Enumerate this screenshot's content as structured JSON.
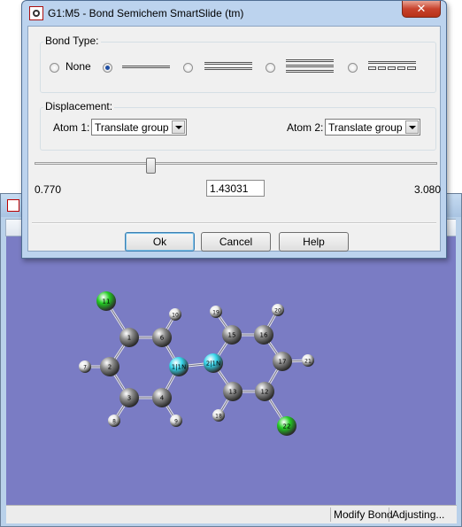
{
  "dialog": {
    "title": "G1:M5 - Bond Semichem SmartSlide (tm)",
    "close_glyph": "✕",
    "bond_type": {
      "label": "Bond Type:",
      "none_label": "None",
      "selected": "single"
    },
    "displacement": {
      "label": "Displacement:",
      "atom1_label": "Atom 1:",
      "atom1_value": "Translate group",
      "atom2_label": "Atom 2:",
      "atom2_value": "Translate group"
    },
    "slider": {
      "min_label": "0.770",
      "max_label": "3.080",
      "value": "1.43031"
    },
    "buttons": {
      "ok": "Ok",
      "cancel": "Cancel",
      "help": "Help"
    }
  },
  "status": {
    "mode": "Modify Bond",
    "state": "Adjusting..."
  },
  "molecule": {
    "atoms": [
      {
        "id": "1",
        "label": "1",
        "element": "C"
      },
      {
        "id": "2",
        "label": "2",
        "element": "C"
      },
      {
        "id": "3",
        "label": "3",
        "element": "C"
      },
      {
        "id": "4",
        "label": "4",
        "element": "C"
      },
      {
        "id": "6",
        "label": "6",
        "element": "C"
      },
      {
        "id": "7",
        "label": "7",
        "element": "H"
      },
      {
        "id": "8",
        "label": "8",
        "element": "H"
      },
      {
        "id": "9",
        "label": "9",
        "element": "H"
      },
      {
        "id": "10",
        "label": "10",
        "element": "H"
      },
      {
        "id": "11",
        "label": "11",
        "element": "Cl"
      },
      {
        "id": "1N",
        "label": "1|1N",
        "element": "N"
      },
      {
        "id": "2N",
        "label": "2|1N",
        "element": "N"
      },
      {
        "id": "12",
        "label": "12",
        "element": "C"
      },
      {
        "id": "13",
        "label": "13",
        "element": "C"
      },
      {
        "id": "15",
        "label": "15",
        "element": "C"
      },
      {
        "id": "16",
        "label": "16",
        "element": "C"
      },
      {
        "id": "17",
        "label": "17",
        "element": "C"
      },
      {
        "id": "18",
        "label": "18",
        "element": "H"
      },
      {
        "id": "19",
        "label": "19",
        "element": "H"
      },
      {
        "id": "20",
        "label": "20",
        "element": "H"
      },
      {
        "id": "21",
        "label": "21",
        "element": "H"
      },
      {
        "id": "22",
        "label": "22",
        "element": "Cl"
      }
    ],
    "colors": {
      "C": "#8c8c8c",
      "H": "#e6e6e6",
      "N": "#35d6ec",
      "Cl": "#22cc22"
    }
  }
}
